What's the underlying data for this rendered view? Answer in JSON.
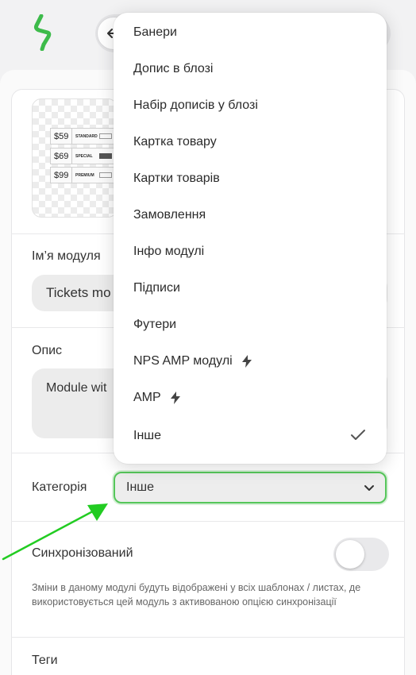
{
  "colors": {
    "accent": "#55c65a",
    "arrow": "#22cc22",
    "brand": "#3dbb4a"
  },
  "preview": {
    "tickets": [
      {
        "price": "$59",
        "name": "STANDARD"
      },
      {
        "price": "$69",
        "name": "SPECIAL"
      },
      {
        "price": "$99",
        "name": "PREMIUM"
      }
    ]
  },
  "form": {
    "module_name_label": "Ім’я модуля",
    "module_name_value": "Tickets mo",
    "description_label": "Опис",
    "description_value": "Module wit",
    "category_label": "Категорія",
    "category_value": "Інше",
    "synced_label": "Синхронізований",
    "synced_on": false,
    "synced_hint": "Зміни в даному модулі будуть відображені у всіх шаблонах / листах, де використовується цей модуль з активованою опцією синхронізації",
    "tags_label": "Теги"
  },
  "dropdown": {
    "items": [
      {
        "label": "Банери",
        "bolt": false
      },
      {
        "label": "Допис в блозі",
        "bolt": false
      },
      {
        "label": "Набір дописів у блозі",
        "bolt": false
      },
      {
        "label": "Картка товару",
        "bolt": false
      },
      {
        "label": "Картки товарів",
        "bolt": false
      },
      {
        "label": "Замовлення",
        "bolt": false
      },
      {
        "label": "Інфо модулі",
        "bolt": false
      },
      {
        "label": "Підписи",
        "bolt": false
      },
      {
        "label": "Футери",
        "bolt": false
      },
      {
        "label": "NPS AMP модулі",
        "bolt": true
      },
      {
        "label": "AMP",
        "bolt": true
      },
      {
        "label": "Інше",
        "bolt": false,
        "selected": true
      }
    ]
  }
}
